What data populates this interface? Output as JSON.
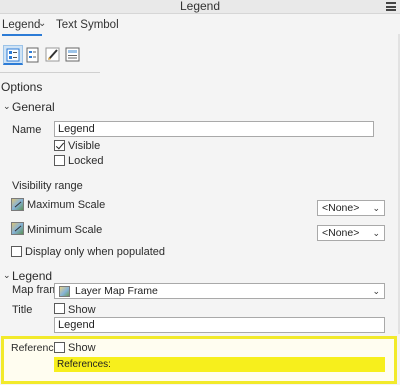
{
  "window": {
    "title": "Legend"
  },
  "tabs": [
    {
      "label": "Legend",
      "active": true
    },
    {
      "label": "Text Symbol",
      "active": false
    }
  ],
  "toolbar_icons": [
    "legend-options-icon",
    "legend-items-icon",
    "symbol-pen-icon",
    "arrangement-icon"
  ],
  "options_title": "Options",
  "general": {
    "title": "General",
    "name_label": "Name",
    "name_value": "Legend",
    "visible_label": "Visible",
    "visible_checked": true,
    "locked_label": "Locked",
    "locked_checked": false,
    "visibility_range_label": "Visibility range",
    "max_scale_label": "Maximum Scale",
    "max_scale_value": "<None>",
    "min_scale_label": "Minimum Scale",
    "min_scale_value": "<None>",
    "display_only_label": "Display only when populated",
    "display_only_checked": false
  },
  "legend": {
    "title": "Legend",
    "map_frame_label": "Map frame",
    "map_frame_value": "Layer Map Frame",
    "title_label": "Title",
    "title_show_label": "Show",
    "title_show_checked": false,
    "title_value": "Legend",
    "references_label": "References",
    "references_show_label": "Show",
    "references_show_checked": false,
    "references_value": "References:"
  },
  "colors": {
    "accent": "#2c7bd6",
    "highlight": "#f2ea2b",
    "field_highlight": "#f7ef1c"
  }
}
